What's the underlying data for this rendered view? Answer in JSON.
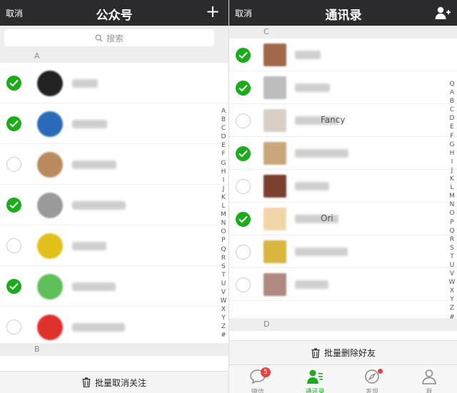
{
  "left": {
    "nav": {
      "cancel": "取消",
      "title": "公众号",
      "plus": "+"
    },
    "search_placeholder": "搜索",
    "sections": [
      "A",
      "B"
    ],
    "rows": [
      {
        "checked": true,
        "color": "#222222"
      },
      {
        "checked": true,
        "color": "#2a6ab8",
        "text": ""
      },
      {
        "checked": false,
        "color": "#b98a5e"
      },
      {
        "checked": true,
        "color": "#9a9a9a"
      },
      {
        "checked": false,
        "color": "#e2c01a"
      },
      {
        "checked": true,
        "color": "#5fbf5a"
      },
      {
        "checked": false,
        "color": "#e0302b"
      }
    ],
    "index": [
      "A",
      "B",
      "C",
      "D",
      "E",
      "F",
      "G",
      "H",
      "I",
      "J",
      "K",
      "L",
      "M",
      "N",
      "O",
      "P",
      "Q",
      "R",
      "S",
      "T",
      "U",
      "V",
      "W",
      "X",
      "Y",
      "Z",
      "#"
    ],
    "bottom_action": "批量取消关注"
  },
  "right": {
    "nav": {
      "cancel": "取消",
      "title": "通讯录"
    },
    "sections": [
      "C",
      "D"
    ],
    "rows": [
      {
        "checked": true,
        "color": "#a2684a"
      },
      {
        "checked": true,
        "color": "#bdbdbd"
      },
      {
        "checked": false,
        "color": "#d8d0c6",
        "name": "Fancy"
      },
      {
        "checked": true,
        "color": "#c9a77c"
      },
      {
        "checked": false,
        "color": "#7a4030"
      },
      {
        "checked": true,
        "color": "#f0d6a8",
        "name": "Ori"
      },
      {
        "checked": false,
        "color": "#d9b640"
      },
      {
        "checked": false,
        "color": "#b08a80"
      }
    ],
    "index": [
      "Q",
      "A",
      "B",
      "C",
      "D",
      "E",
      "F",
      "G",
      "H",
      "I",
      "J",
      "K",
      "L",
      "M",
      "N",
      "O",
      "P",
      "Q",
      "R",
      "S",
      "T",
      "U",
      "V",
      "W",
      "X",
      "Y",
      "Z",
      "#"
    ],
    "bottom_action": "批量删除好友",
    "tabs": [
      {
        "label": "微信",
        "badge": "5"
      },
      {
        "label": "通讯录"
      },
      {
        "label": "发现"
      },
      {
        "label": "我"
      }
    ]
  },
  "colors": {
    "check_green": "#1aad19",
    "navbar": "#2b2a2e",
    "badge_red": "#e64340"
  }
}
